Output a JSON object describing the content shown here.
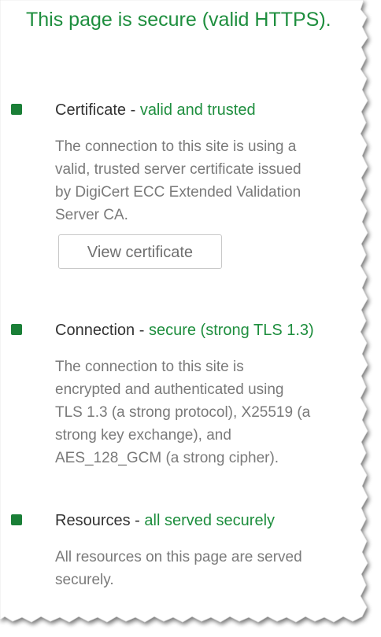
{
  "headline": "This page is secure (valid HTTPS).",
  "sections": [
    {
      "name": "Certificate",
      "separator": " - ",
      "status": "valid and trusted",
      "description": "The connection to this site is using a\nvalid, trusted server certificate issued\nby DigiCert ECC Extended Validation\nServer CA.",
      "button_label": "View certificate"
    },
    {
      "name": "Connection",
      "separator": " - ",
      "status": "secure (strong TLS 1.3)",
      "description": "The connection to this site is\nencrypted and authenticated using\nTLS 1.3 (a strong protocol), X25519 (a\nstrong key exchange), and\nAES_128_GCM (a strong cipher)."
    },
    {
      "name": "Resources",
      "separator": " - ",
      "status": "all served securely",
      "description": "All resources on this page are served\nsecurely."
    }
  ],
  "colors": {
    "secure_green": "#1e8e3e",
    "bullet_green": "#1a7f37",
    "body_gray": "#7a7a7a",
    "title_dark": "#333333"
  }
}
